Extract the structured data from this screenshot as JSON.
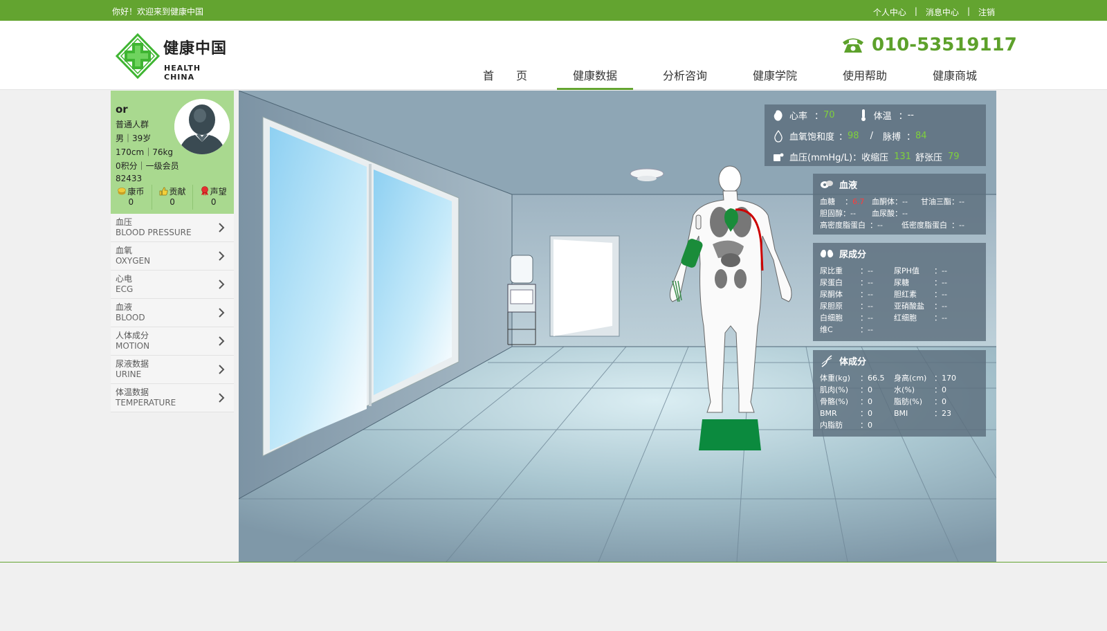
{
  "topbar": {
    "welcome": "你好！欢迎来到健康中国",
    "links": [
      "个人中心",
      "消息中心",
      "注销"
    ],
    "separator": "|"
  },
  "header": {
    "logo_cn": "健康中国",
    "logo_en": "HEALTH CHINA",
    "phone": "010-53519117",
    "nav": [
      {
        "label": "首　　页",
        "active": false
      },
      {
        "label": "健康数据",
        "active": true
      },
      {
        "label": "分析咨询",
        "active": false
      },
      {
        "label": "健康学院",
        "active": false
      },
      {
        "label": "使用帮助",
        "active": false
      },
      {
        "label": "健康商城",
        "active": false
      }
    ]
  },
  "profile": {
    "username": "or",
    "group": "普通人群",
    "gender_age": "男｜39岁",
    "height_weight": "170cm｜76kg",
    "points_level": "0积分｜一级会员",
    "user_id": "82433",
    "stats": [
      {
        "label": "康币",
        "value": "0"
      },
      {
        "label": "贡献",
        "value": "0"
      },
      {
        "label": "声望",
        "value": "0"
      }
    ]
  },
  "menu": [
    {
      "cn": "血压",
      "en": "BLOOD PRESSURE"
    },
    {
      "cn": "血氧",
      "en": "OXYGEN"
    },
    {
      "cn": "心电",
      "en": "ECG"
    },
    {
      "cn": "血液",
      "en": "BLOOD"
    },
    {
      "cn": "人体成分",
      "en": "MOTION"
    },
    {
      "cn": "尿液数据",
      "en": "URINE"
    },
    {
      "cn": "体温数据",
      "en": "TEMPERATURE"
    }
  ],
  "vitals": {
    "heart_rate_label": "心率",
    "heart_rate": "70",
    "temp_label": "体温",
    "temp": "--",
    "spo2_label": "血氧饱和度",
    "spo2": "98",
    "slash": "/",
    "pulse_label": "脉搏",
    "pulse": "84",
    "bp_label": "血压(mmHg/L)：收缩压",
    "systolic": "131",
    "diastolic_label": "舒张压",
    "diastolic": "79"
  },
  "blood": {
    "title": "血液",
    "items": [
      {
        "label": "血糖",
        "value": "6.7"
      },
      {
        "label": "血酮体",
        "value": "--"
      },
      {
        "label": "甘油三酯",
        "value": "--"
      },
      {
        "label": "胆固醇",
        "value": "--"
      },
      {
        "label": "血尿酸",
        "value": "--"
      },
      {
        "label": "高密度脂蛋白",
        "value": "--"
      },
      {
        "label": "低密度脂蛋白",
        "value": "--"
      }
    ]
  },
  "urine": {
    "title": "尿成分",
    "items": [
      {
        "label": "尿比重",
        "value": "--"
      },
      {
        "label": "尿PH值",
        "value": "--"
      },
      {
        "label": "尿蛋白",
        "value": "--"
      },
      {
        "label": "尿糖",
        "value": "--"
      },
      {
        "label": "尿酮体",
        "value": "--"
      },
      {
        "label": "胆红素",
        "value": "--"
      },
      {
        "label": "尿胆原",
        "value": "--"
      },
      {
        "label": "亚硝酸盐",
        "value": "--"
      },
      {
        "label": "白细胞",
        "value": "--"
      },
      {
        "label": "红细胞",
        "value": "--"
      },
      {
        "label": "维C",
        "value": "--"
      }
    ]
  },
  "body": {
    "title": "体成分",
    "items": [
      {
        "label": "体重(kg)",
        "value": "66.5"
      },
      {
        "label": "身高(cm)",
        "value": "170"
      },
      {
        "label": "肌肉(%)",
        "value": "0"
      },
      {
        "label": "水(%)",
        "value": "0"
      },
      {
        "label": "骨骼(%)",
        "value": "0"
      },
      {
        "label": "脂肪(%)",
        "value": "0"
      },
      {
        "label": "BMR",
        "value": "0"
      },
      {
        "label": "BMI",
        "value": "23"
      },
      {
        "label": "内脂肪",
        "value": "0"
      }
    ]
  },
  "colors": {
    "brand_green": "#63a430",
    "value_green": "#7fd13b",
    "alert_red": "#ff3b3b",
    "sidebar_profile": "#a9d98f"
  }
}
